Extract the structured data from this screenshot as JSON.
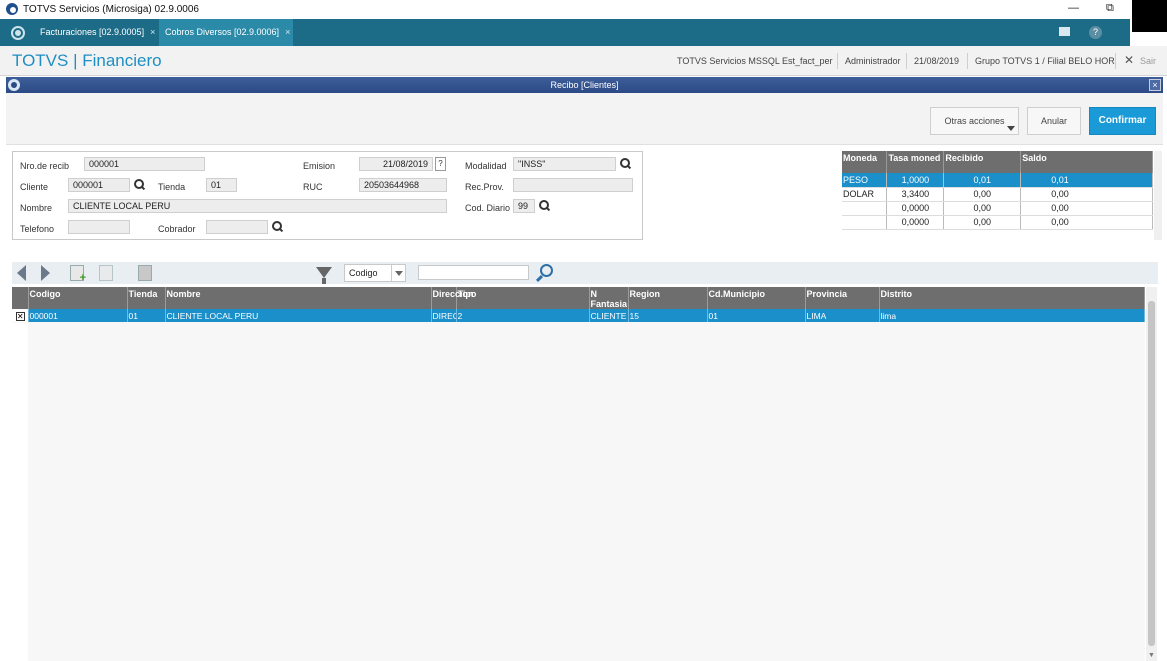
{
  "window": {
    "title": "TOTVS Servicios (Microsiga) 02.9.0006",
    "restore_glyph": "⧉",
    "minimize_glyph": "—"
  },
  "tabs": [
    {
      "label": "Facturaciones [02.9.0005]",
      "close": "×",
      "active": false
    },
    {
      "label": "Cobros Diversos [02.9.0006]",
      "close": "×",
      "active": true
    }
  ],
  "topbar": {
    "help": "?"
  },
  "module": {
    "brand": "TOTVS | Financiero",
    "env": "TOTVS Servicios MSSQL Est_fact_per",
    "user": "Administrador",
    "date": "21/08/2019",
    "branch": "Grupo TOTVS 1 / Filial BELO HOR",
    "exit": "Sair",
    "exit_glyph": "✕"
  },
  "dialog": {
    "title": "Recibo [Clientes]",
    "close": "×"
  },
  "actions": {
    "other": "Otras acciones",
    "cancel": "Anular",
    "confirm": "Confirmar"
  },
  "form": {
    "nro_label": "Nro.de recib",
    "nro_value": "000001",
    "emision_label": "Emision",
    "emision_value": "21/08/2019",
    "emision_help": "?",
    "modalidad_label": "Modalidad",
    "modalidad_value": "\"INSS\"",
    "cliente_label": "Cliente",
    "cliente_value": "000001",
    "tienda_label": "Tienda",
    "tienda_value": "01",
    "ruc_label": "RUC",
    "ruc_value": "20503644968",
    "recprov_label": "Rec.Prov.",
    "recprov_value": "",
    "nombre_label": "Nombre",
    "nombre_value": "CLIENTE LOCAL PERU",
    "coddiario_label": "Cod. Diario",
    "coddiario_value": "99",
    "telefono_label": "Telefono",
    "telefono_value": "",
    "cobrador_label": "Cobrador",
    "cobrador_value": ""
  },
  "currency_table": {
    "headers": [
      "Moneda",
      "Tasa moned",
      "Recibido",
      "Saldo"
    ],
    "rows": [
      [
        "PESO",
        "1,0000",
        "0,01",
        "0,01"
      ],
      [
        "DOLAR",
        "3,3400",
        "0,00",
        "0,00"
      ],
      [
        "",
        "0,0000",
        "0,00",
        "0,00"
      ],
      [
        "",
        "0,0000",
        "0,00",
        "0,00"
      ]
    ]
  },
  "toolbar": {
    "filter_field": "Codigo"
  },
  "grid": {
    "headers": [
      "Codigo",
      "Tienda",
      "Nombre",
      "Direccion",
      "Tipo",
      "N Fantasia",
      "Region",
      "Cd.Municipio",
      "Provincia",
      "Distrito"
    ],
    "rows": [
      {
        "checked": "✕",
        "cells": [
          "000001",
          "01",
          "CLIENTE LOCAL PERU",
          "DIRECCION",
          "2",
          "CLIENTE LOCAL PERU",
          "15",
          "01",
          "LIMA",
          "lima"
        ]
      }
    ]
  },
  "colors": {
    "tabbar": "#1c6c88",
    "primary": "#1a9ad6",
    "selection": "#1a8fc9",
    "header": "#6e6e6e",
    "dialog_title": "#2b4a86"
  }
}
